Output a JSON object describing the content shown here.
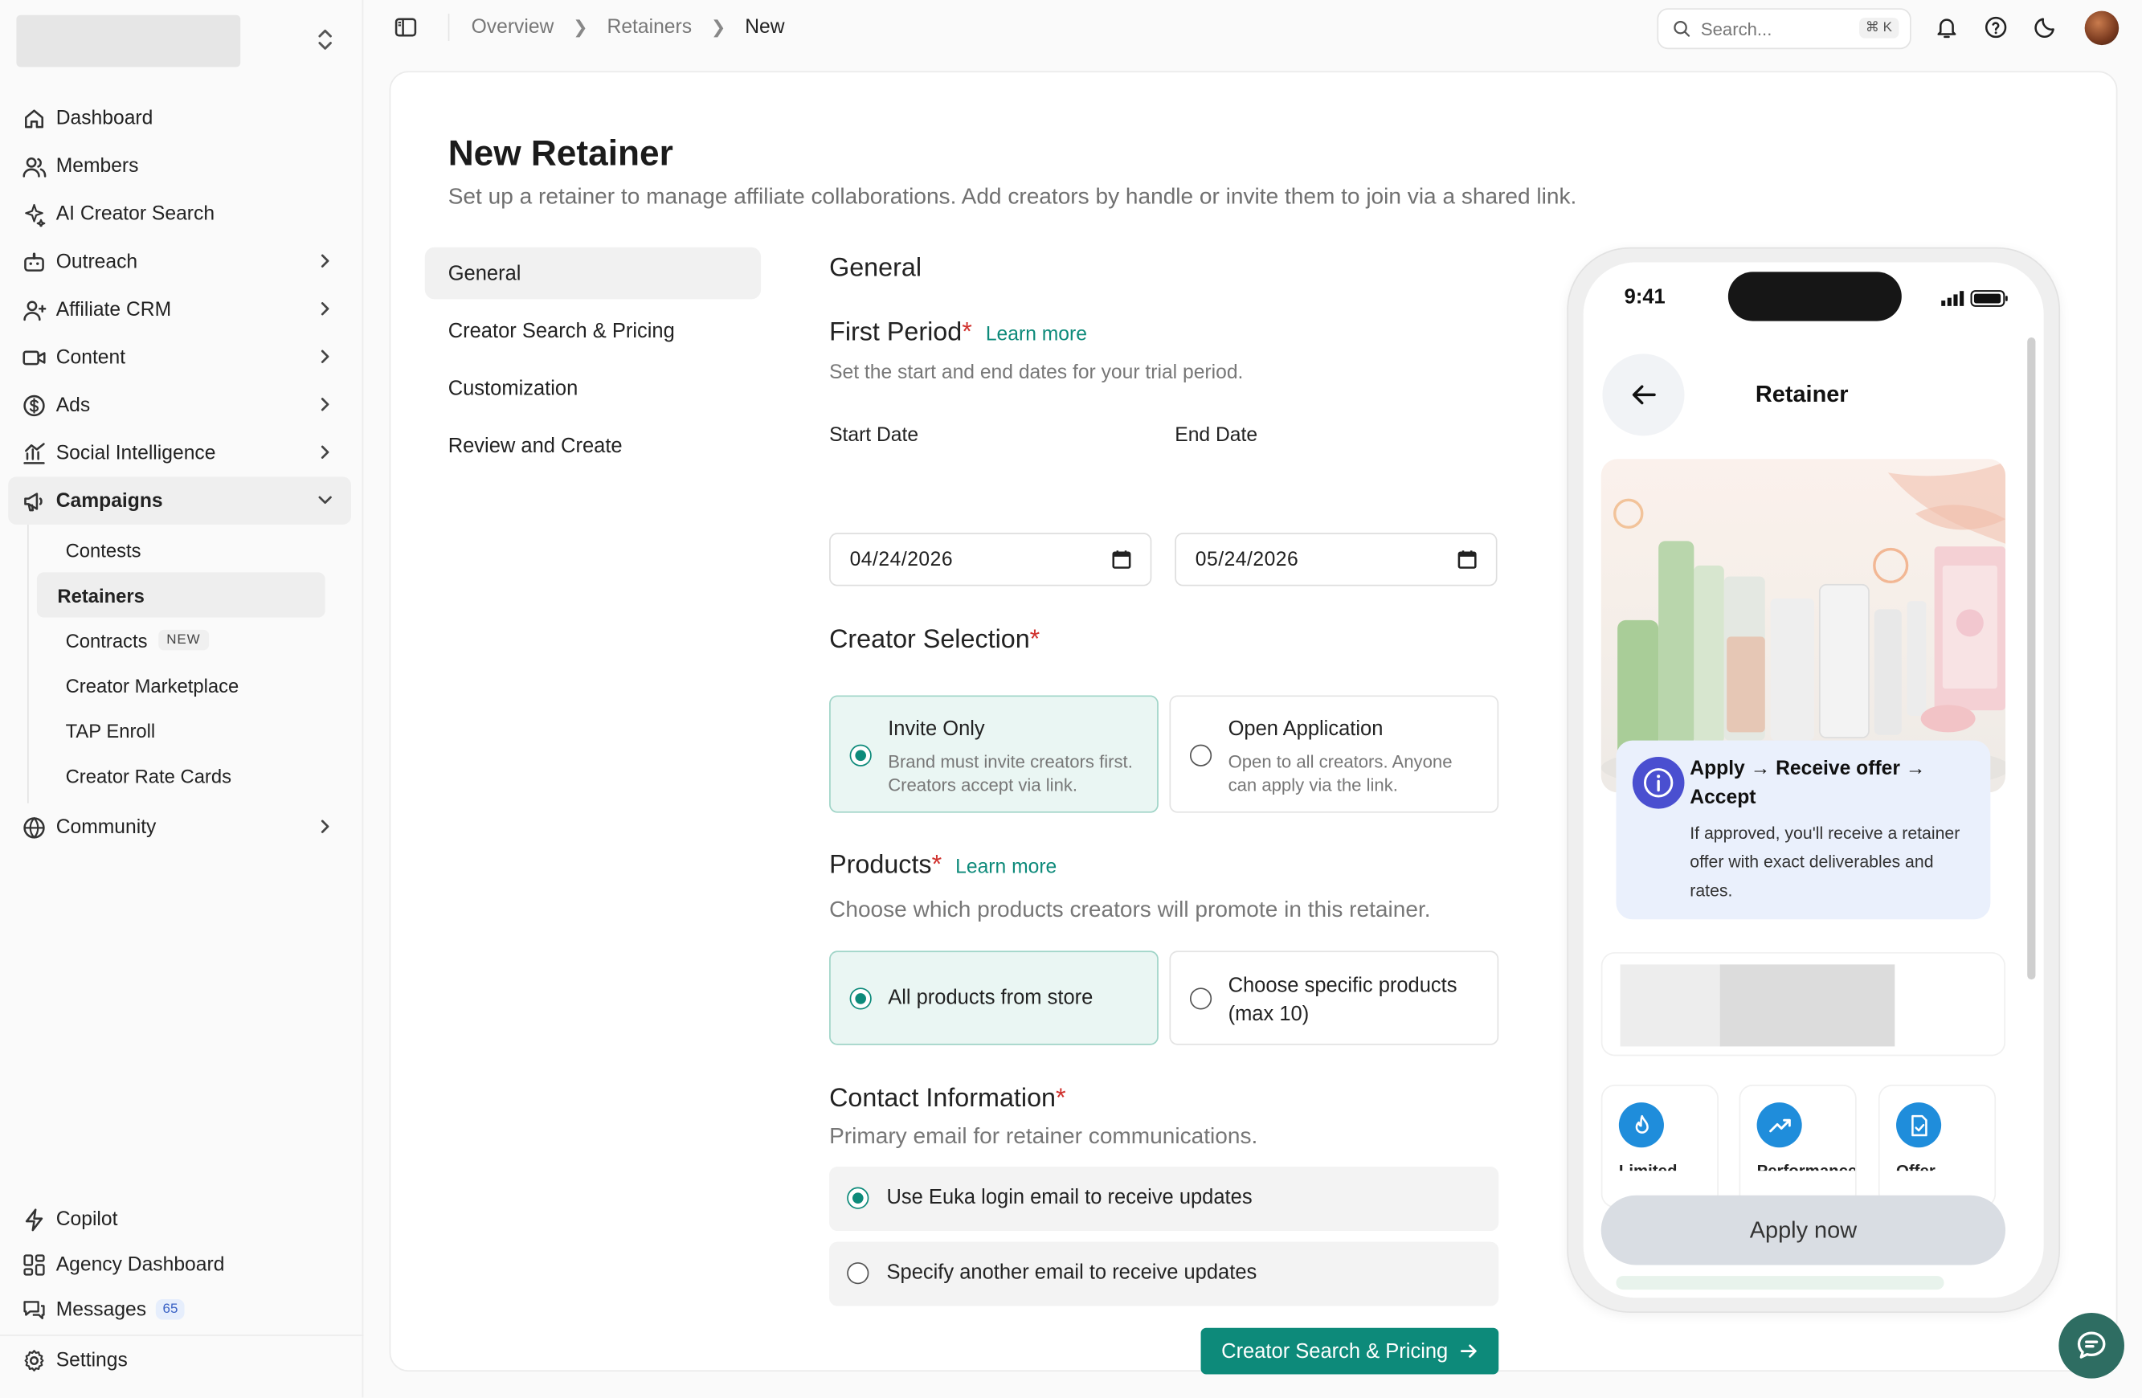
{
  "sidebar": {
    "items": [
      {
        "label": "Dashboard",
        "icon": "home-icon"
      },
      {
        "label": "Members",
        "icon": "users-icon"
      },
      {
        "label": "AI Creator Search",
        "icon": "sparkle-icon"
      },
      {
        "label": "Outreach",
        "icon": "robot-icon"
      },
      {
        "label": "Affiliate CRM",
        "icon": "user-icon"
      },
      {
        "label": "Content",
        "icon": "video-icon"
      },
      {
        "label": "Ads",
        "icon": "dollar-icon"
      },
      {
        "label": "Social Intelligence",
        "icon": "chart-icon"
      },
      {
        "label": "Campaigns",
        "icon": "megaphone-icon"
      }
    ],
    "campaigns_sub": [
      {
        "label": "Contests"
      },
      {
        "label": "Retainers"
      },
      {
        "label": "Contracts",
        "badge": "NEW"
      },
      {
        "label": "Creator Marketplace"
      },
      {
        "label": "TAP Enroll"
      },
      {
        "label": "Creator Rate Cards"
      }
    ],
    "community": {
      "label": "Community",
      "icon": "globe-icon"
    },
    "bottom": [
      {
        "label": "Copilot",
        "icon": "bolt-icon"
      },
      {
        "label": "Agency Dashboard",
        "icon": "grid-icon"
      },
      {
        "label": "Messages",
        "icon": "messages-icon",
        "badge": "65"
      }
    ],
    "settings": {
      "label": "Settings",
      "icon": "gear-icon"
    }
  },
  "topbar": {
    "breadcrumbs": [
      "Overview",
      "Retainers",
      "New"
    ],
    "search_placeholder": "Search...",
    "search_shortcut": "⌘ K"
  },
  "page": {
    "title": "New Retainer",
    "subtitle": "Set up a retainer to manage affiliate collaborations. Add creators by handle or invite them to join via a shared link."
  },
  "steps": [
    "General",
    "Creator Search & Pricing",
    "Customization",
    "Review and Create"
  ],
  "form": {
    "section_title": "General",
    "first_period": {
      "title": "First Period",
      "required": "*",
      "learn_more": "Learn more",
      "help": "Set the start and end dates for your trial period.",
      "start_label": "Start Date",
      "start_value": "04/24/2026",
      "end_label": "End Date",
      "end_value": "05/24/2026"
    },
    "creator_selection": {
      "title": "Creator Selection",
      "required": "*",
      "options": [
        {
          "title": "Invite Only",
          "desc": "Brand must invite creators first. Creators accept via link.",
          "selected": true
        },
        {
          "title": "Open Application",
          "desc": "Open to all creators. Anyone can apply via the link.",
          "selected": false
        }
      ]
    },
    "products": {
      "title": "Products",
      "required": "*",
      "learn_more": "Learn more",
      "help": "Choose which products creators will promote in this retainer.",
      "options": [
        {
          "title": "All products from store",
          "selected": true
        },
        {
          "title": "Choose specific products (max 10)",
          "selected": false
        }
      ]
    },
    "contact": {
      "title": "Contact Information",
      "required": "*",
      "help": "Primary email for retainer communications.",
      "options": [
        {
          "title": "Use Euka login email to receive updates",
          "selected": true
        },
        {
          "title": "Specify another email to receive updates",
          "selected": false
        }
      ]
    },
    "next_button": "Creator Search & Pricing"
  },
  "phone": {
    "time": "9:41",
    "title": "Retainer",
    "info_title": "Apply → Receive offer → Accept",
    "info_desc": "If approved, you'll receive a retainer offer with exact deliverables and rates.",
    "features": [
      {
        "label": "Limited",
        "icon": "flame-icon"
      },
      {
        "label": "Performance",
        "icon": "trend-up-icon"
      },
      {
        "label": "Offer",
        "icon": "document-check-icon"
      }
    ],
    "apply_button": "Apply now"
  },
  "colors": {
    "accent": "#0d8a7a",
    "required": "#d0312d",
    "selected_bg": "#eaf6f3"
  }
}
